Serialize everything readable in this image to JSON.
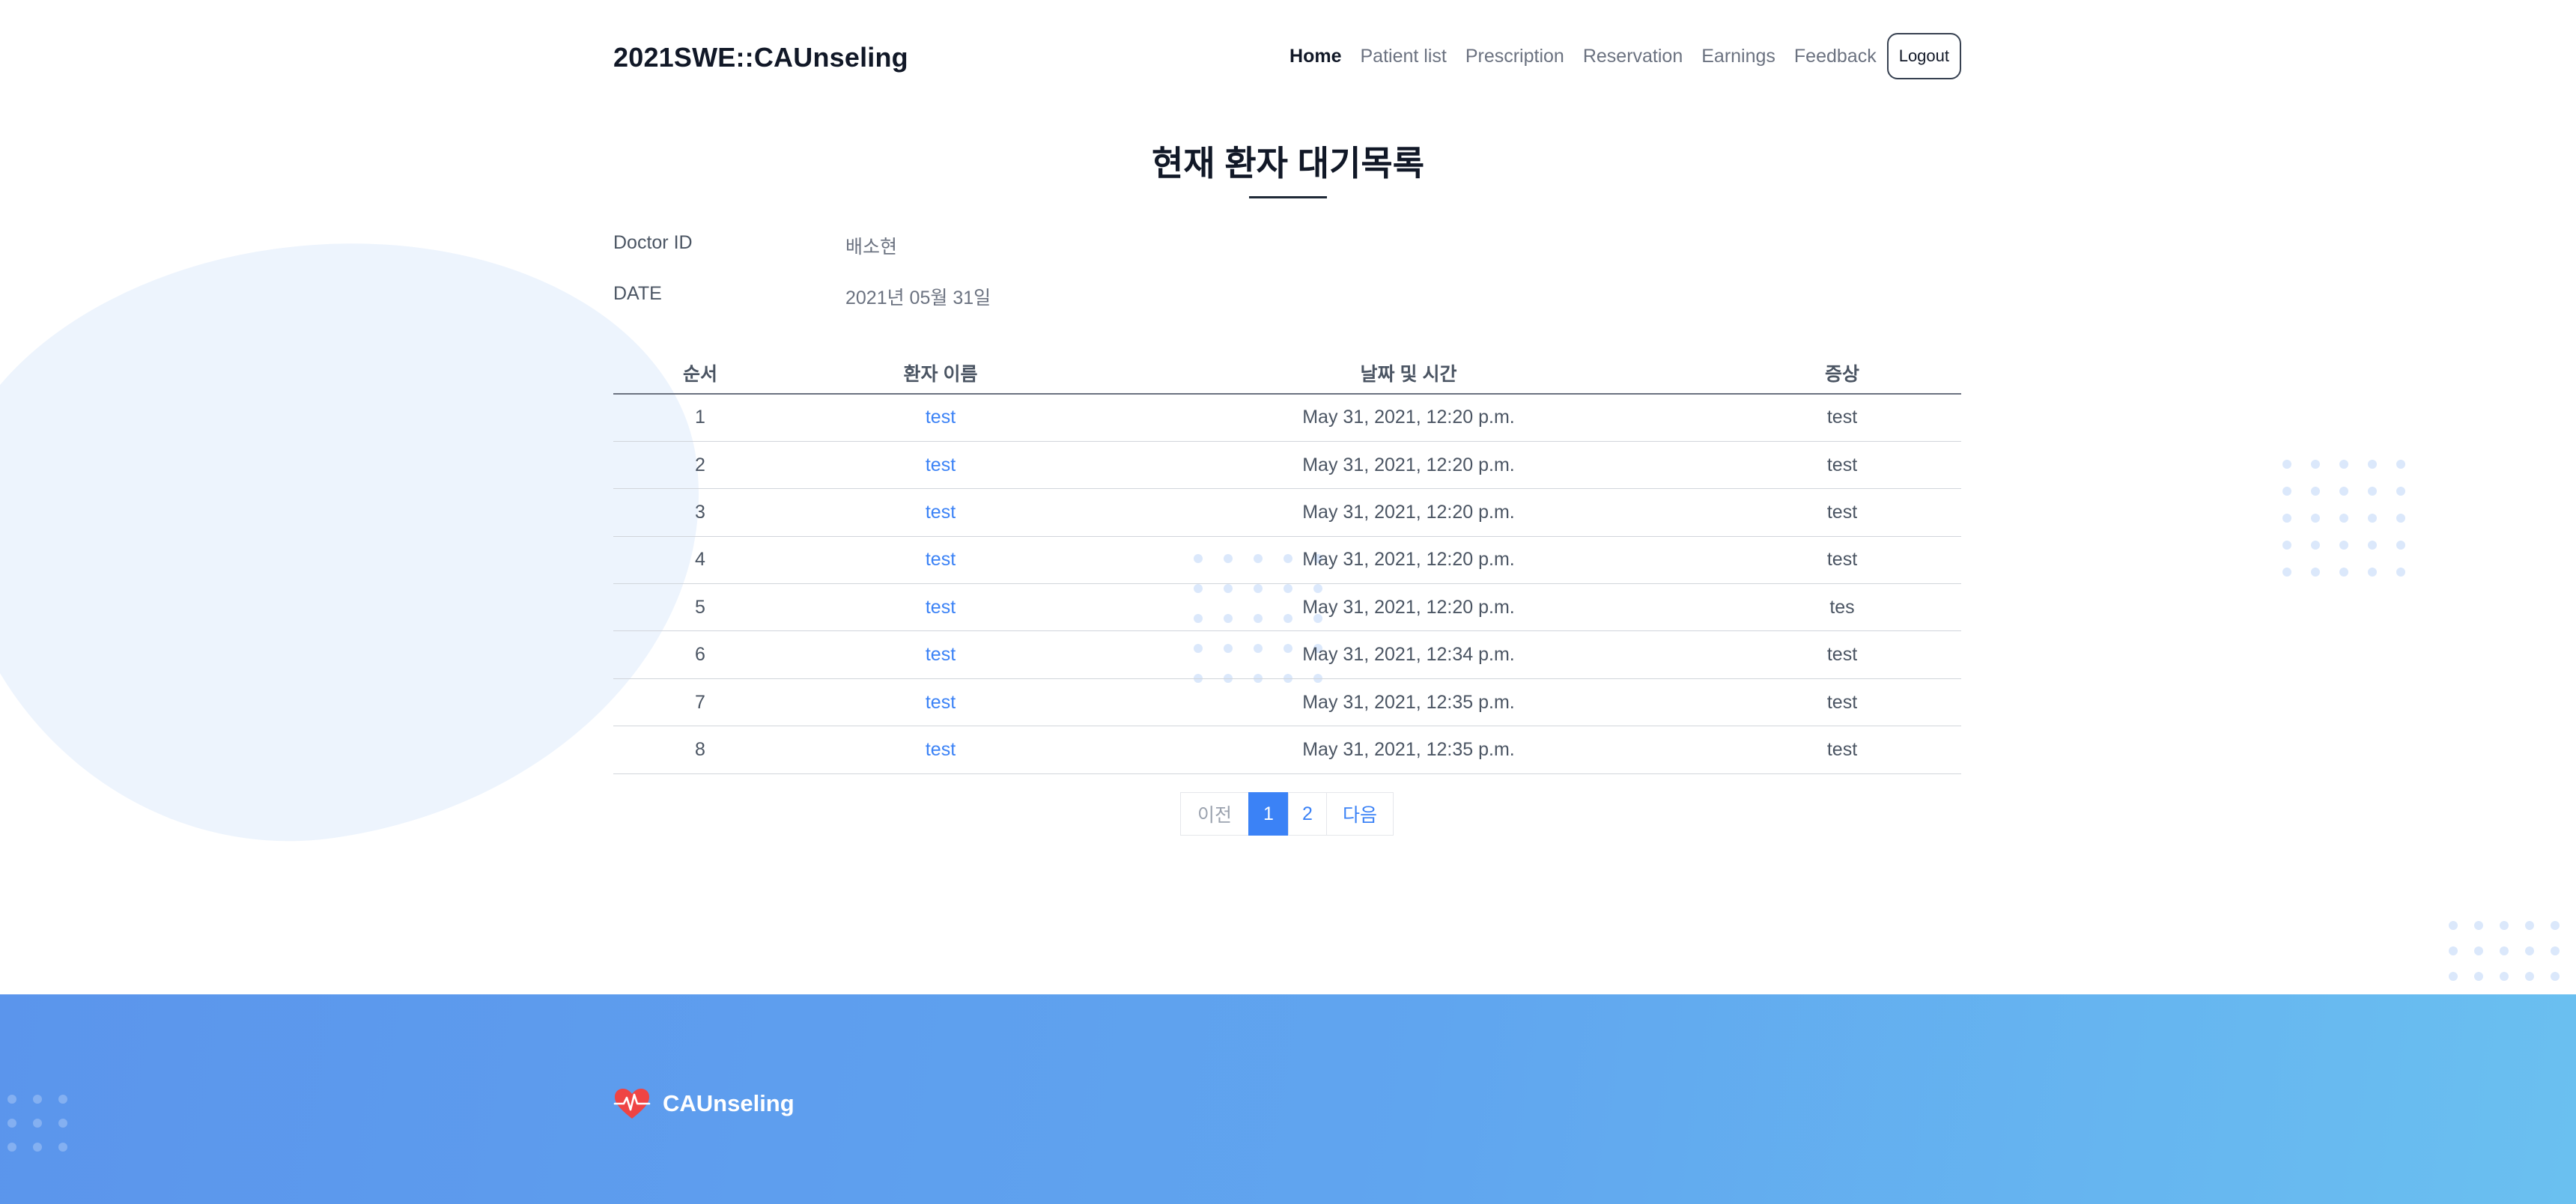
{
  "header": {
    "brand": "2021SWE::CAUnseling",
    "nav": [
      {
        "label": "Home",
        "active": true
      },
      {
        "label": "Patient list",
        "active": false
      },
      {
        "label": "Prescription",
        "active": false
      },
      {
        "label": "Reservation",
        "active": false
      },
      {
        "label": "Earnings",
        "active": false
      },
      {
        "label": "Feedback",
        "active": false
      }
    ],
    "logout_label": "Logout"
  },
  "page": {
    "title": "현재 환자 대기목록"
  },
  "info": {
    "doctor_label": "Doctor ID",
    "doctor_value": "배소현",
    "date_label": "DATE",
    "date_value": "2021년 05월 31일"
  },
  "table": {
    "headers": [
      "순서",
      "환자 이름",
      "날짜 및 시간",
      "증상"
    ],
    "rows": [
      {
        "order": "1",
        "name": "test",
        "datetime": "May 31, 2021, 12:20 p.m.",
        "symptom": "test"
      },
      {
        "order": "2",
        "name": "test",
        "datetime": "May 31, 2021, 12:20 p.m.",
        "symptom": "test"
      },
      {
        "order": "3",
        "name": "test",
        "datetime": "May 31, 2021, 12:20 p.m.",
        "symptom": "test"
      },
      {
        "order": "4",
        "name": "test",
        "datetime": "May 31, 2021, 12:20 p.m.",
        "symptom": "test"
      },
      {
        "order": "5",
        "name": "test",
        "datetime": "May 31, 2021, 12:20 p.m.",
        "symptom": "tes"
      },
      {
        "order": "6",
        "name": "test",
        "datetime": "May 31, 2021, 12:34 p.m.",
        "symptom": "test"
      },
      {
        "order": "7",
        "name": "test",
        "datetime": "May 31, 2021, 12:35 p.m.",
        "symptom": "test"
      },
      {
        "order": "8",
        "name": "test",
        "datetime": "May 31, 2021, 12:35 p.m.",
        "symptom": "test"
      }
    ]
  },
  "pagination": {
    "prev": "이전",
    "pages": [
      "1",
      "2"
    ],
    "current": "1",
    "next": "다음"
  },
  "footer": {
    "brand": "CAUnseling",
    "logo_icon": "heart-pulse-icon"
  },
  "colors": {
    "accent": "#3b82f6",
    "footer_start": "#5b95ec",
    "footer_end": "#6ac0f0",
    "logo_heart": "#ef4444"
  }
}
